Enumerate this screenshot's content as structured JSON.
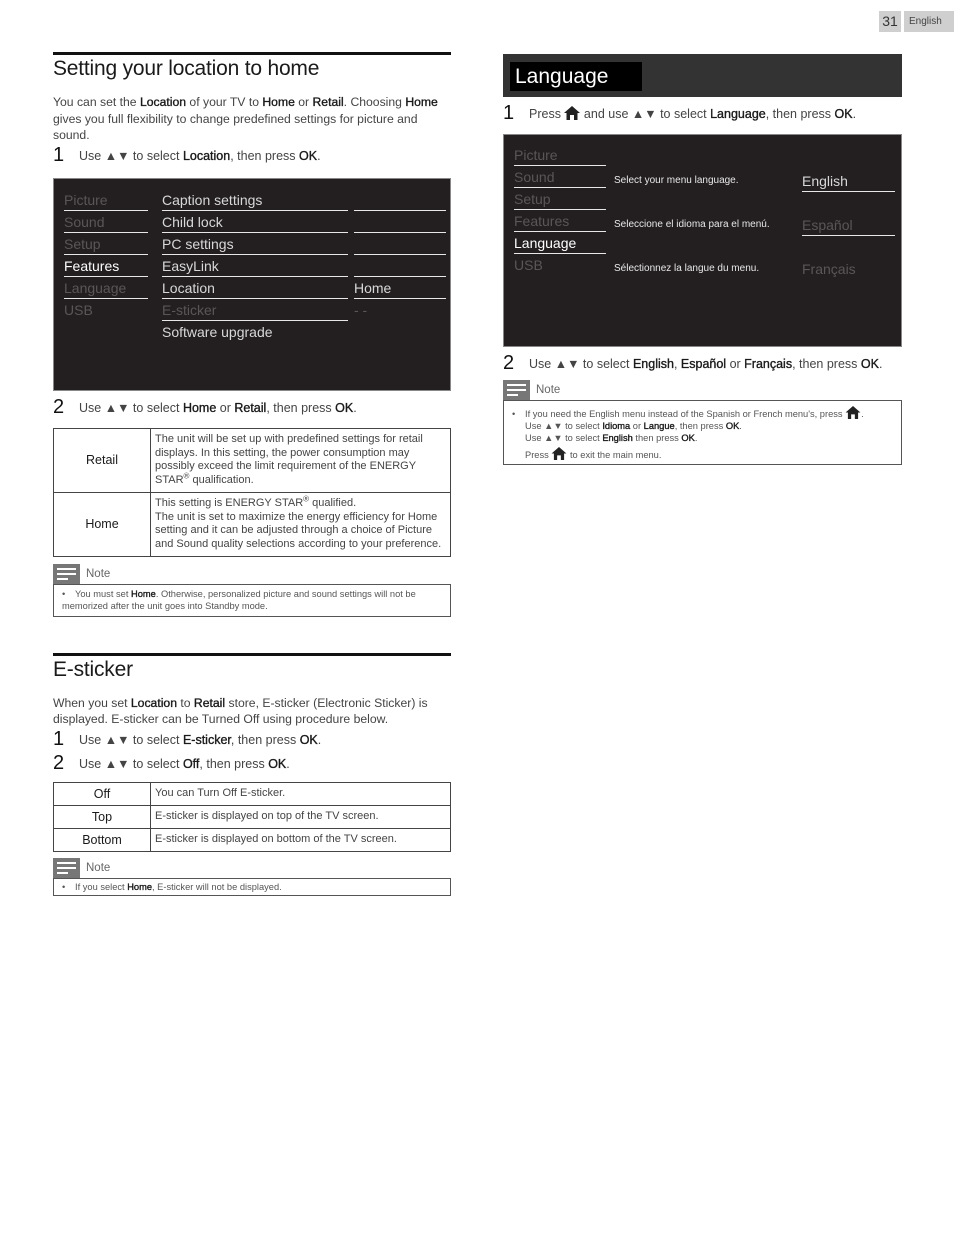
{
  "page": {
    "number": "31",
    "language_tab": "English"
  },
  "location_section": {
    "title": "Setting your location to home",
    "intro": [
      {
        "t": "You can set the "
      },
      {
        "b": "Location"
      },
      {
        "t": " of your TV to "
      },
      {
        "b": "Home"
      },
      {
        "t": " or "
      },
      {
        "b": "Retail"
      },
      {
        "t": ". Choosing "
      },
      {
        "b": "Home"
      },
      {
        "t": " gives you full flexibility to change predefined settings for picture and sound."
      }
    ],
    "step1": {
      "num": "1",
      "pre": "Use ▲▼ to select ",
      "bold": "Location",
      "post": ", then press ",
      "ok": "OK",
      "end": "."
    },
    "menu": {
      "categories": [
        {
          "label": "Picture",
          "state": "dim"
        },
        {
          "label": "Sound",
          "state": "dim"
        },
        {
          "label": "Setup",
          "state": "dim"
        },
        {
          "label": "Features",
          "state": "selected"
        },
        {
          "label": "Language",
          "state": "dim"
        },
        {
          "label": "USB",
          "state": "dim"
        }
      ],
      "items": [
        {
          "label": "Caption settings",
          "value": "",
          "state": "lite"
        },
        {
          "label": "Child lock",
          "value": "",
          "state": "lite"
        },
        {
          "label": "PC settings",
          "value": "",
          "state": "lite"
        },
        {
          "label": "EasyLink",
          "value": "",
          "state": "lite"
        },
        {
          "label": "Location",
          "value": "Home",
          "state": "lite"
        },
        {
          "label": "E-sticker",
          "value": "- -",
          "state": "dim"
        },
        {
          "label": "Software upgrade",
          "value": "",
          "state": "lite"
        }
      ]
    },
    "step2": {
      "num": "2",
      "pre": "Use ▲▼ to select ",
      "bold1": "Home",
      "mid": " or ",
      "bold2": "Retail",
      "post": ", then press ",
      "ok": "OK",
      "end": "."
    },
    "options": [
      {
        "key": "Retail",
        "desc_pre": "The unit will be set up with predefined settings for retail displays. In this setting, the power consumption may possibly exceed the limit requirement of the ENERGY STAR",
        "sup": "®",
        "desc_post": " qualification."
      },
      {
        "key": "Home",
        "desc_pre": "This setting is ENERGY STAR",
        "sup": "®",
        "desc_post": " qualified.",
        "desc_line2": "The unit is set to maximize the energy efficiency for Home setting and it can be adjusted through a choice of Picture and Sound quality selections according to your preference."
      }
    ],
    "note": {
      "label": "Note",
      "pre": "You must set ",
      "bold": "Home",
      "post": ". Otherwise, personalized picture and sound settings will not be memorized after the unit goes into Standby mode."
    }
  },
  "esticker_section": {
    "title": "E-sticker",
    "intro": [
      {
        "t": "When you set "
      },
      {
        "b": "Location"
      },
      {
        "t": " to "
      },
      {
        "b": "Retail"
      },
      {
        "t": " store, E-sticker (Electronic Sticker) is displayed. E-sticker can be Turned Off using procedure below."
      }
    ],
    "step1": {
      "num": "1",
      "pre": "Use ▲▼ to select ",
      "bold": "E-sticker",
      "post": ", then press ",
      "ok": "OK",
      "end": "."
    },
    "step2": {
      "num": "2",
      "pre": "Use ▲▼ to select ",
      "bold": "Off",
      "post": ", then press ",
      "ok": "OK",
      "end": "."
    },
    "options": [
      {
        "key": "Off",
        "desc": "You can Turn Off E-sticker."
      },
      {
        "key": "Top",
        "desc": "E-sticker is displayed on top of the TV screen."
      },
      {
        "key": "Bottom",
        "desc": "E-sticker is displayed on bottom of the TV screen."
      }
    ],
    "note": {
      "label": "Note",
      "pre": "If you select ",
      "bold": "Home",
      "post": ", E-sticker will not be displayed."
    }
  },
  "language_section": {
    "title": "Language",
    "step1": {
      "num": "1",
      "pre": "Press ",
      "mid": " and use ▲▼ to select ",
      "bold": "Language",
      "post": ", then press ",
      "ok": "OK",
      "end": "."
    },
    "menu": {
      "categories": [
        {
          "label": "Picture",
          "state": "dim"
        },
        {
          "label": "Sound",
          "state": "dim"
        },
        {
          "label": "Setup",
          "state": "dim"
        },
        {
          "label": "Features",
          "state": "dim"
        },
        {
          "label": "Language",
          "state": "selected"
        },
        {
          "label": "USB",
          "state": "dim"
        }
      ],
      "prompts": [
        {
          "text": "Select your menu language.",
          "option": "English",
          "state": "lite"
        },
        {
          "text": "Seleccione el idioma para el menú.",
          "option": "Español",
          "state": "dim"
        },
        {
          "text": "Sélectionnez la langue du menu.",
          "option": "Français",
          "state": "dim"
        }
      ]
    },
    "step2": {
      "num": "2",
      "pre": "Use ▲▼ to select ",
      "b1": "English",
      "s1": ", ",
      "b2": "Español",
      "s2": " or ",
      "b3": "Français",
      "post": ", then press ",
      "ok": "OK",
      "end": "."
    },
    "note": {
      "label": "Note",
      "line1_pre": "If you need the English menu instead of the Spanish or French menu's, press ",
      "line1_end": ".",
      "line2_pre": "Use ▲▼ to select ",
      "line2_b1": "Idioma",
      "line2_mid": " or ",
      "line2_b2": "Langue",
      "line2_post": ", then press ",
      "line2_ok": "OK",
      "line2_end": ".",
      "line3_pre": "Use ▲▼ to select ",
      "line3_b": "English",
      "line3_post": " then press ",
      "line3_ok": "OK",
      "line3_end": ".",
      "line4_pre": "Press ",
      "line4_post": " to exit the main menu."
    }
  }
}
